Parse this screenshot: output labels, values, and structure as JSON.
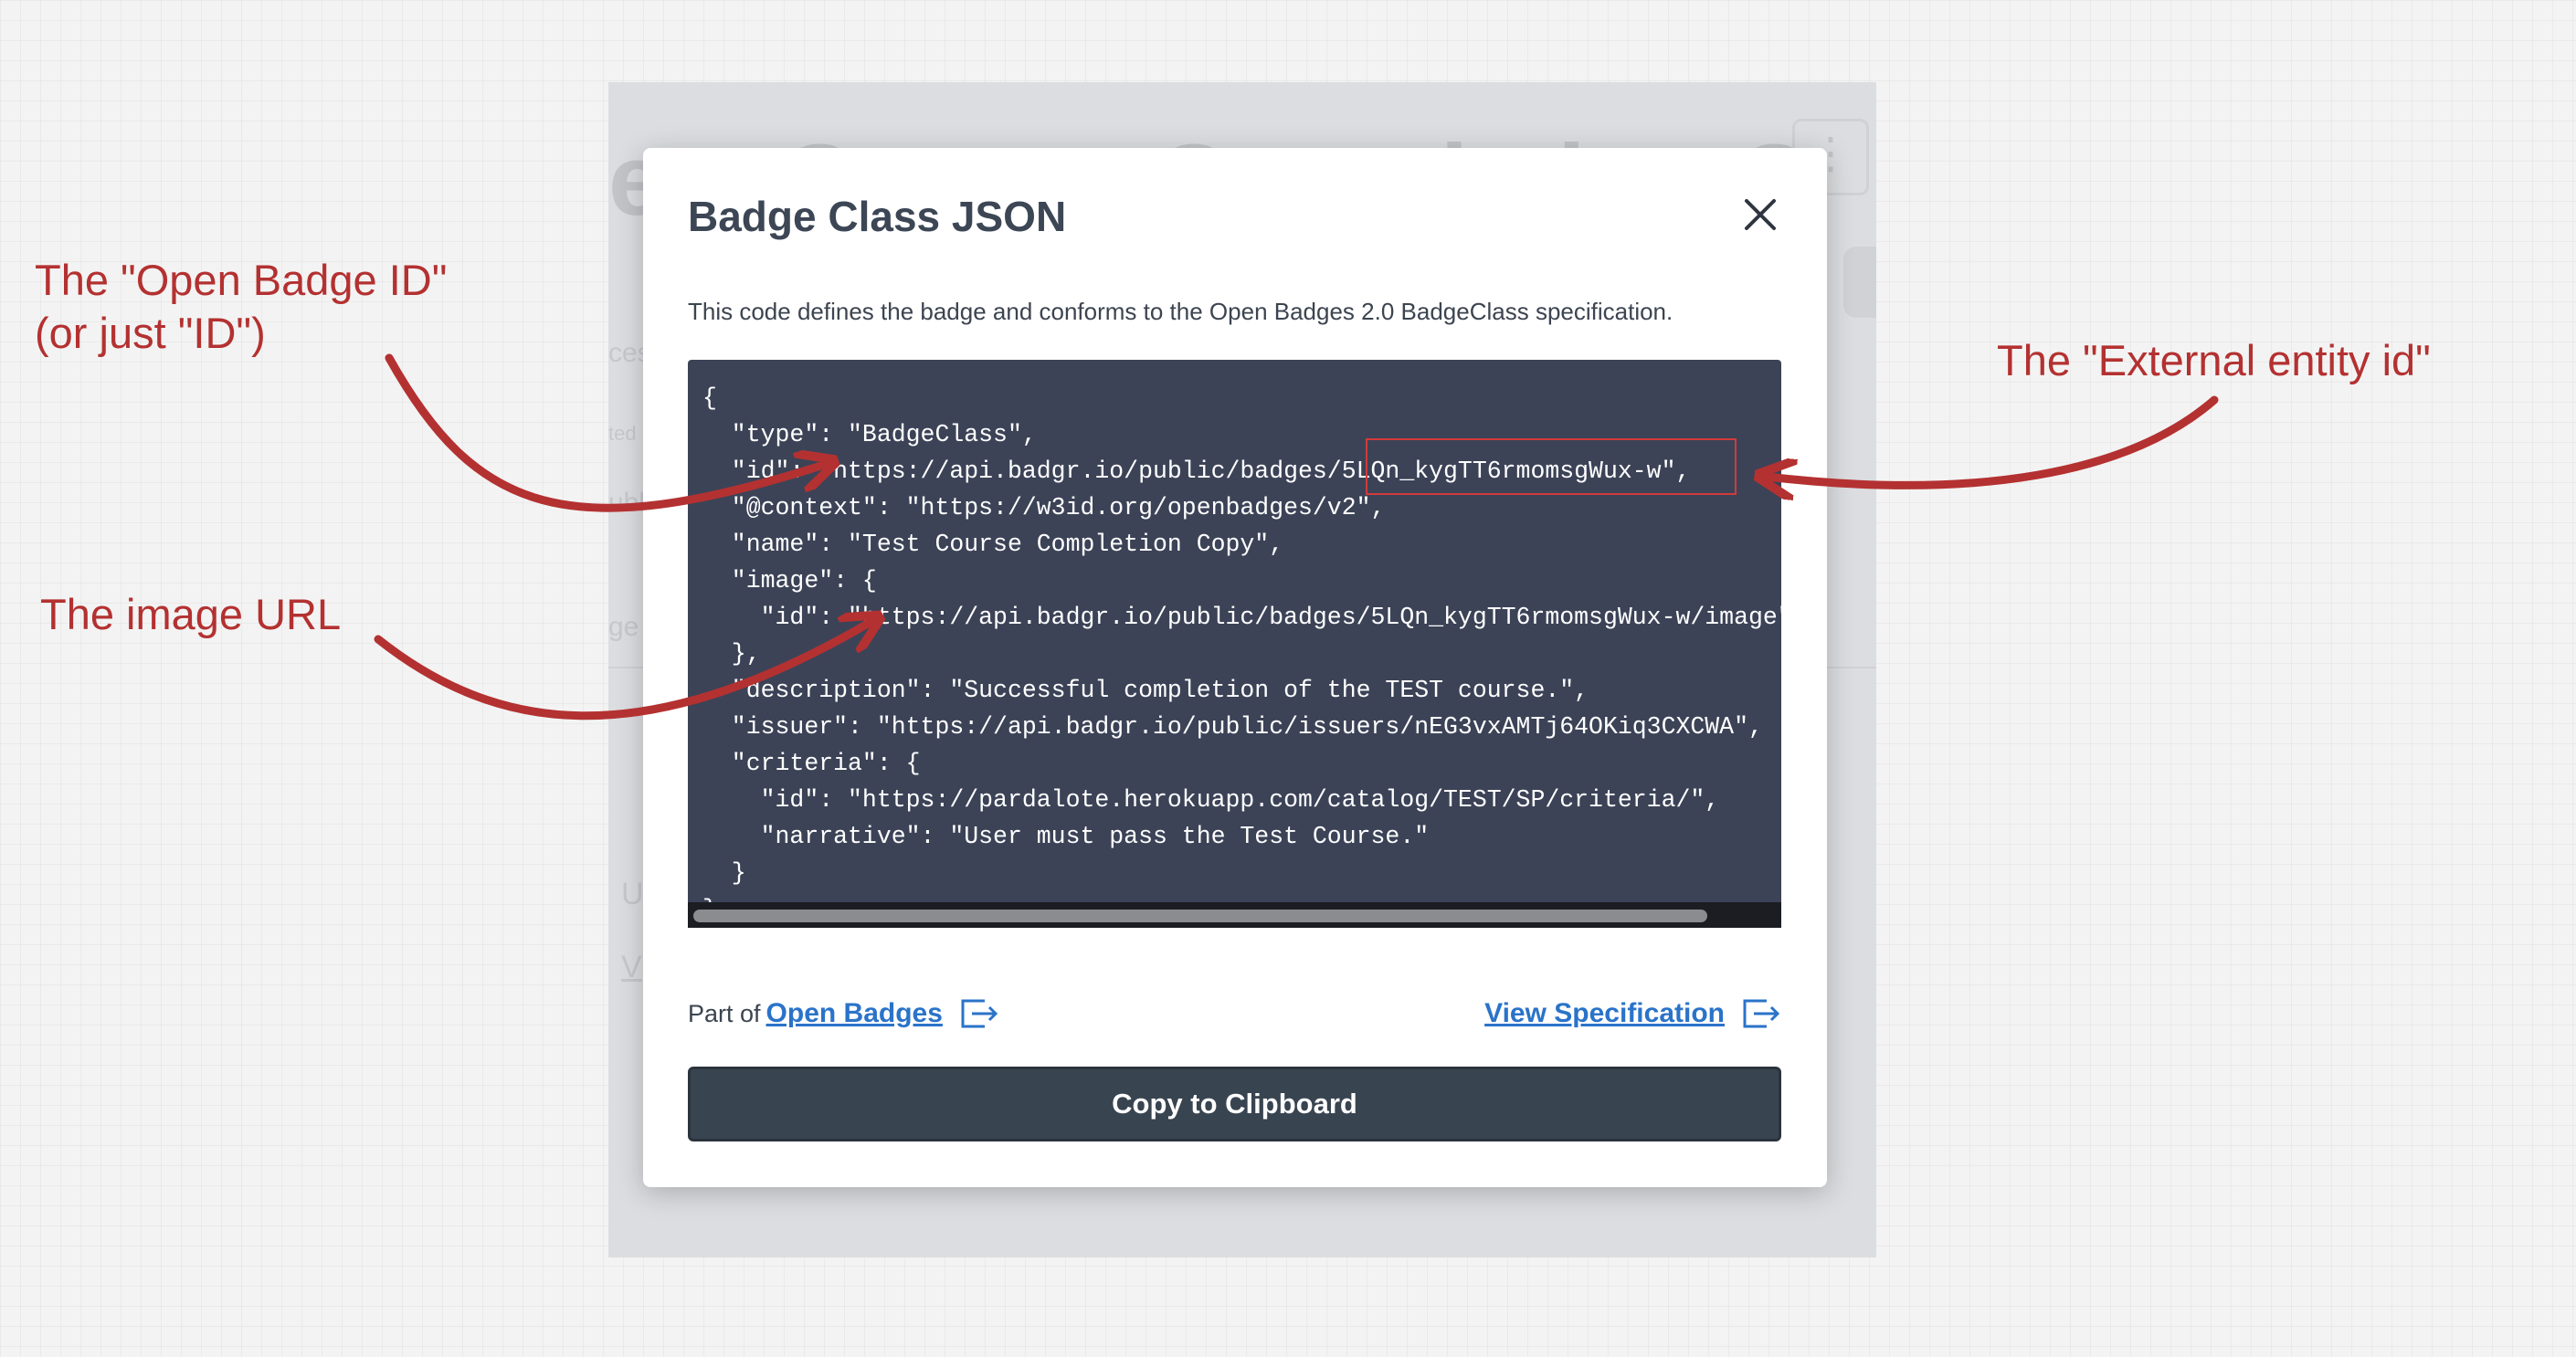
{
  "background": {
    "title_fragment": "est Course Completion C",
    "kebab_icon": "vertical-ellipsis-icon",
    "faint_labels": [
      "ces",
      "ted",
      "ubl",
      "ge",
      "U",
      "V"
    ]
  },
  "modal": {
    "title": "Badge Class JSON",
    "close_icon": "close-icon",
    "description": "This code defines the badge and conforms to the Open Badges 2.0 BadgeClass specification.",
    "code_lines": [
      "{",
      "  \"type\": \"BadgeClass\",",
      "  \"id\": \"https://api.badgr.io/public/badges/5LQn_kygTT6rmomsgWux-w\",",
      "  \"@context\": \"https://w3id.org/openbadges/v2\",",
      "  \"name\": \"Test Course Completion Copy\",",
      "  \"image\": {",
      "    \"id\": \"https://api.badgr.io/public/badges/5LQn_kygTT6rmomsgWux-w/image\"",
      "  },",
      "  \"description\": \"Successful completion of the TEST course.\",",
      "  \"issuer\": \"https://api.badgr.io/public/issuers/nEG3vxAMTj64OKiq3CXCWA\",",
      "  \"criteria\": {",
      "    \"id\": \"https://pardalote.herokuapp.com/catalog/TEST/SP/criteria/\",",
      "    \"narrative\": \"User must pass the Test Course.\"",
      "  }",
      "}"
    ],
    "footer": {
      "part_of_prefix": "Part of",
      "open_badges_link": "Open Badges",
      "view_spec_link": "View Specification",
      "external_icon": "external-link-icon"
    },
    "copy_button_label": "Copy to Clipboard"
  },
  "annotations": {
    "open_badge_id_line1": "The \"Open Badge ID\"",
    "open_badge_id_line2": "(or just \"ID\")",
    "image_url": "The image URL",
    "external_entity_id": "The \"External entity id\"",
    "color": "#b43131"
  }
}
